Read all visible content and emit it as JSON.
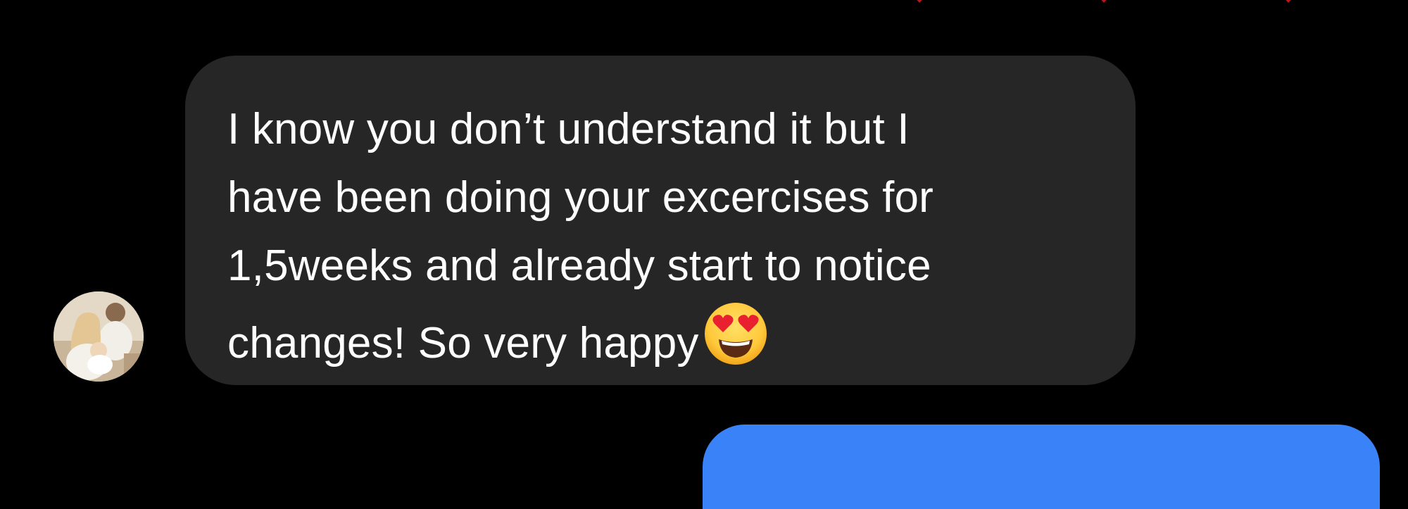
{
  "conversation": {
    "reaction_color": "#c0161b",
    "incoming_message": {
      "lines": [
        "I know you don’t understand it but I",
        "have been doing your excercises for",
        "1,5weeks and already start to notice",
        "changes! So very happy"
      ],
      "emoji_icon": "heart-eyes-emoji",
      "bubble_color": "#262626",
      "text_color": "#ffffff"
    },
    "outgoing_message": {
      "bubble_color": "#3a82f7"
    },
    "sender_avatar": {
      "icon": "profile-photo"
    }
  }
}
